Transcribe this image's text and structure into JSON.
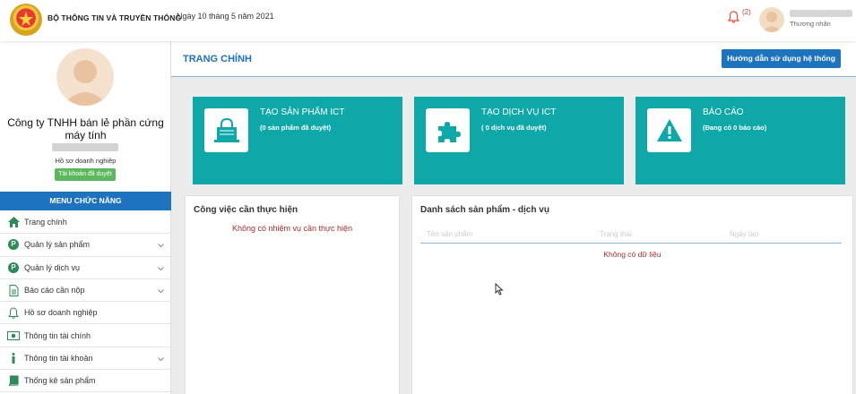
{
  "header": {
    "org_name": "BỘ THÔNG TIN VÀ TRUYỀN THÔNG",
    "date": "Ngày 10 tháng 5 năm 2021",
    "notification_count": "(2)",
    "user_role": "Thương nhân"
  },
  "sidebar": {
    "company_name": "Công ty TNHH bán lẻ phần cứng máy tính",
    "profile_label": "Hồ sơ doanh nghiệp",
    "verified_badge": "Tài khoản đã duyệt",
    "menu_title": "MENU CHỨC NĂNG",
    "items": [
      {
        "label": "Trang chính",
        "icon": "home-icon"
      },
      {
        "label": "Quản lý sản phẩm",
        "icon": "p-circle-icon"
      },
      {
        "label": "Quản lý dịch vụ",
        "icon": "p-circle-icon"
      },
      {
        "label": "Báo cáo cần nộp",
        "icon": "document-icon"
      },
      {
        "label": "Hồ sơ doanh nghiệp",
        "icon": "bell-icon"
      },
      {
        "label": "Thông tin tài chính",
        "icon": "money-icon"
      },
      {
        "label": "Thông tin tài khoản",
        "icon": "info-icon"
      },
      {
        "label": "Thống kê sản phẩm",
        "icon": "book-icon"
      }
    ]
  },
  "main": {
    "page_title": "TRANG CHÍNH",
    "guide_button": "Hướng dẫn sử dụng hệ thống",
    "tiles": [
      {
        "title": "TẠO SẢN PHẨM ICT",
        "subtitle": "(0 sản phẩm đã duyệt)",
        "icon": "shopping-bag-icon"
      },
      {
        "title": "TẠO DỊCH VỤ ICT",
        "subtitle": "( 0 dịch vụ đã duyệt)",
        "icon": "puzzle-icon"
      },
      {
        "title": "BÁO CÁO",
        "subtitle": "(Đang có 0 báo cáo)",
        "icon": "warning-icon"
      }
    ],
    "tasks_panel": {
      "title": "Công việc cần thực hiện",
      "empty": "Không có nhiệm vụ cần thực hiện"
    },
    "products_panel": {
      "title": "Danh sách sản phẩm - dịch vụ",
      "columns": [
        "Tên sản phẩm",
        "Trạng thái",
        "Ngày tạo"
      ],
      "empty": "Không có dữ liệu"
    }
  },
  "colors": {
    "primary": "#1e73be",
    "tile": "#0fa8a8",
    "success": "#5cb85c",
    "alert": "#c0392b"
  }
}
